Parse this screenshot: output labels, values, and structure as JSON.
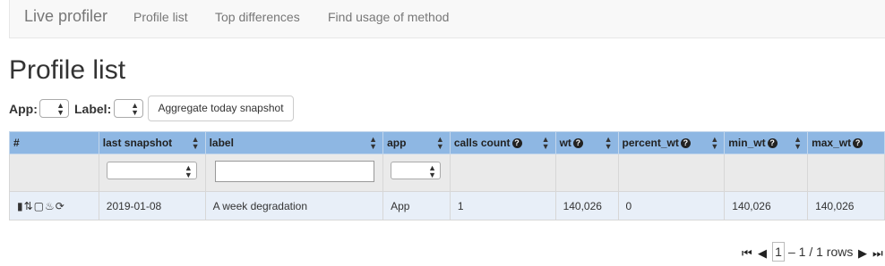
{
  "navbar": {
    "brand": "Live profiler",
    "links": [
      "Profile list",
      "Top differences",
      "Find usage of method"
    ]
  },
  "page_title": "Profile list",
  "toolbar": {
    "app_label": "App:",
    "label_label": "Label:",
    "aggregate_button": "Aggregate today snapshot"
  },
  "table": {
    "columns": [
      "#",
      "last snapshot",
      "label",
      "app",
      "calls count",
      "wt",
      "percent_wt",
      "min_wt",
      "max_wt"
    ],
    "rows": [
      {
        "actions": "▮⇅▢♨⟳",
        "last_snapshot": "2019-01-08",
        "label": "A week degradation",
        "app": "App",
        "calls_count": "1",
        "wt": "140,026",
        "percent_wt": "0",
        "min_wt": "140,026",
        "max_wt": "140,026"
      }
    ]
  },
  "pager": {
    "current_page": "1",
    "range_text": "– 1 / 1 rows"
  },
  "colors": {
    "header_bg": "#8eb7e3",
    "row_bg": "#e8eff8",
    "accent": "#337ab7"
  }
}
